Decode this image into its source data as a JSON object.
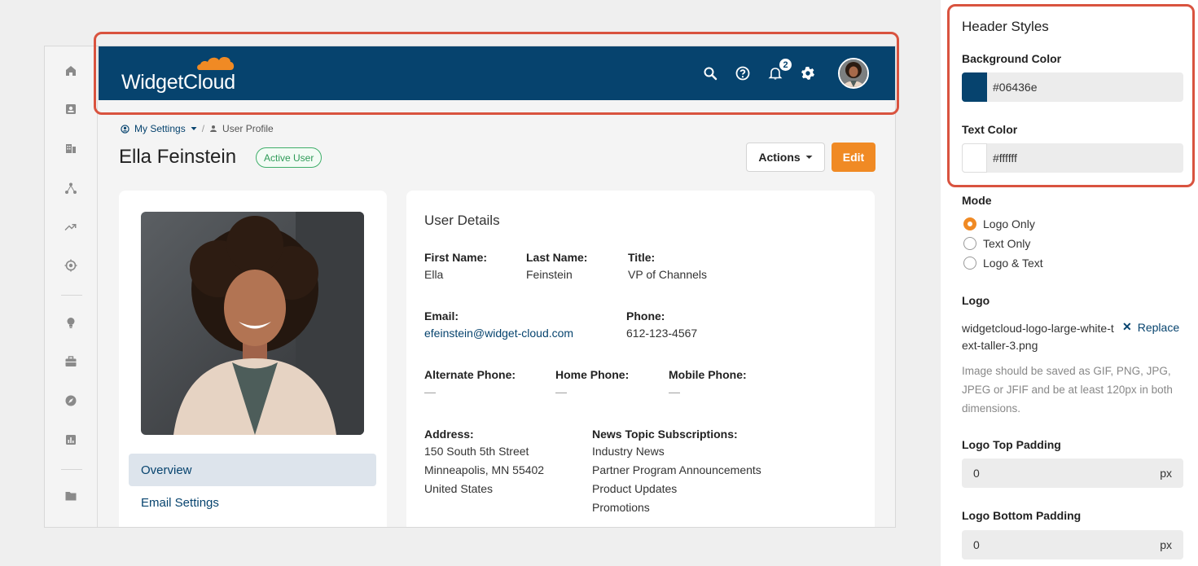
{
  "colors": {
    "header_bg": "#06436e",
    "header_text": "#ffffff",
    "accent": "#f08a24",
    "highlight": "#d9533f",
    "link": "#06436e"
  },
  "rail": {
    "icons": [
      "home-icon",
      "contacts-icon",
      "building-icon",
      "network-icon",
      "trending-icon",
      "target-icon",
      "lightbulb-icon",
      "briefcase-icon",
      "compass-icon",
      "chart-icon",
      "folder-icon"
    ]
  },
  "header": {
    "logo_text": "WidgetCloud",
    "icons": [
      "search-icon",
      "help-icon",
      "bell-icon",
      "gear-icon"
    ],
    "notification_count": "2"
  },
  "breadcrumb": {
    "my_settings": "My Settings",
    "separator": "/",
    "current": "User Profile"
  },
  "page": {
    "title": "Ella Feinstein",
    "status": "Active User",
    "actions_label": "Actions",
    "edit_label": "Edit"
  },
  "left_nav": {
    "items": [
      "Overview",
      "Email Settings"
    ]
  },
  "user_details": {
    "title": "User Details",
    "first_name_label": "First Name:",
    "first_name": "Ella",
    "last_name_label": "Last Name:",
    "last_name": "Feinstein",
    "title_label": "Title:",
    "job_title": "VP of Channels",
    "email_label": "Email:",
    "email": "efeinstein@widget-cloud.com",
    "phone_label": "Phone:",
    "phone": "612-123-4567",
    "alt_phone_label": "Alternate Phone:",
    "alt_phone": "—",
    "home_phone_label": "Home Phone:",
    "home_phone": "—",
    "mobile_phone_label": "Mobile Phone:",
    "mobile_phone": "—",
    "address_label": "Address:",
    "address_lines": [
      "150 South 5th Street",
      "Minneapolis, MN 55402",
      "United States"
    ],
    "news_label": "News Topic Subscriptions:",
    "news_topics": [
      "Industry News",
      "Partner Program Announcements",
      "Product Updates",
      "Promotions"
    ]
  },
  "panel": {
    "heading": "Header Styles",
    "bg_color_label": "Background Color",
    "bg_color_value": "#06436e",
    "text_color_label": "Text Color",
    "text_color_value": "#ffffff",
    "mode_label": "Mode",
    "mode_options": [
      "Logo Only",
      "Text Only",
      "Logo & Text"
    ],
    "mode_selected": "Logo Only",
    "logo_label": "Logo",
    "logo_file": "widgetcloud-logo-large-white-text-taller-3.png",
    "replace_label": "Replace",
    "logo_help": "Image should be saved as GIF, PNG, JPG, JPEG or JFIF and be at least 120px in both dimensions.",
    "top_padding_label": "Logo Top Padding",
    "top_padding_value": "0",
    "bottom_padding_label": "Logo Bottom Padding",
    "bottom_padding_value": "0",
    "unit": "px"
  }
}
